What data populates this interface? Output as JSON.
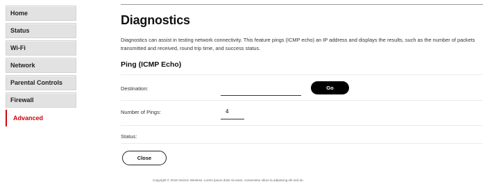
{
  "sidebar": {
    "items": [
      {
        "label": "Home"
      },
      {
        "label": "Status"
      },
      {
        "label": "Wi-Fi"
      },
      {
        "label": "Network"
      },
      {
        "label": "Parental Controls"
      },
      {
        "label": "Firewall"
      },
      {
        "label": "Advanced"
      }
    ],
    "active_item": "Advanced"
  },
  "main": {
    "title": "Diagnostics",
    "description": "Diagnostics can assist in testing network connectivity. This feature pings (ICMP echo) an IP address and displays the results, such as the number of packets transmitted and received, round trip time, and success status.",
    "section_title": "Ping (ICMP Echo)",
    "fields": {
      "destination": {
        "label": "Destination:",
        "value": ""
      },
      "go_label": "Go",
      "pings": {
        "label": "Number of Pings:",
        "value": "4"
      },
      "status": {
        "label": "Status:"
      }
    },
    "close_label": "Close",
    "footer": "Copyright © 2019 Verizon Wireless. Lorem ipsum dolor sit amet, consectetur ullum la adipiscing elit sed do."
  },
  "colors": {
    "accent": "#cd040b",
    "button_dark": "#000000",
    "sidebar_bg": "#e2e2e2"
  }
}
